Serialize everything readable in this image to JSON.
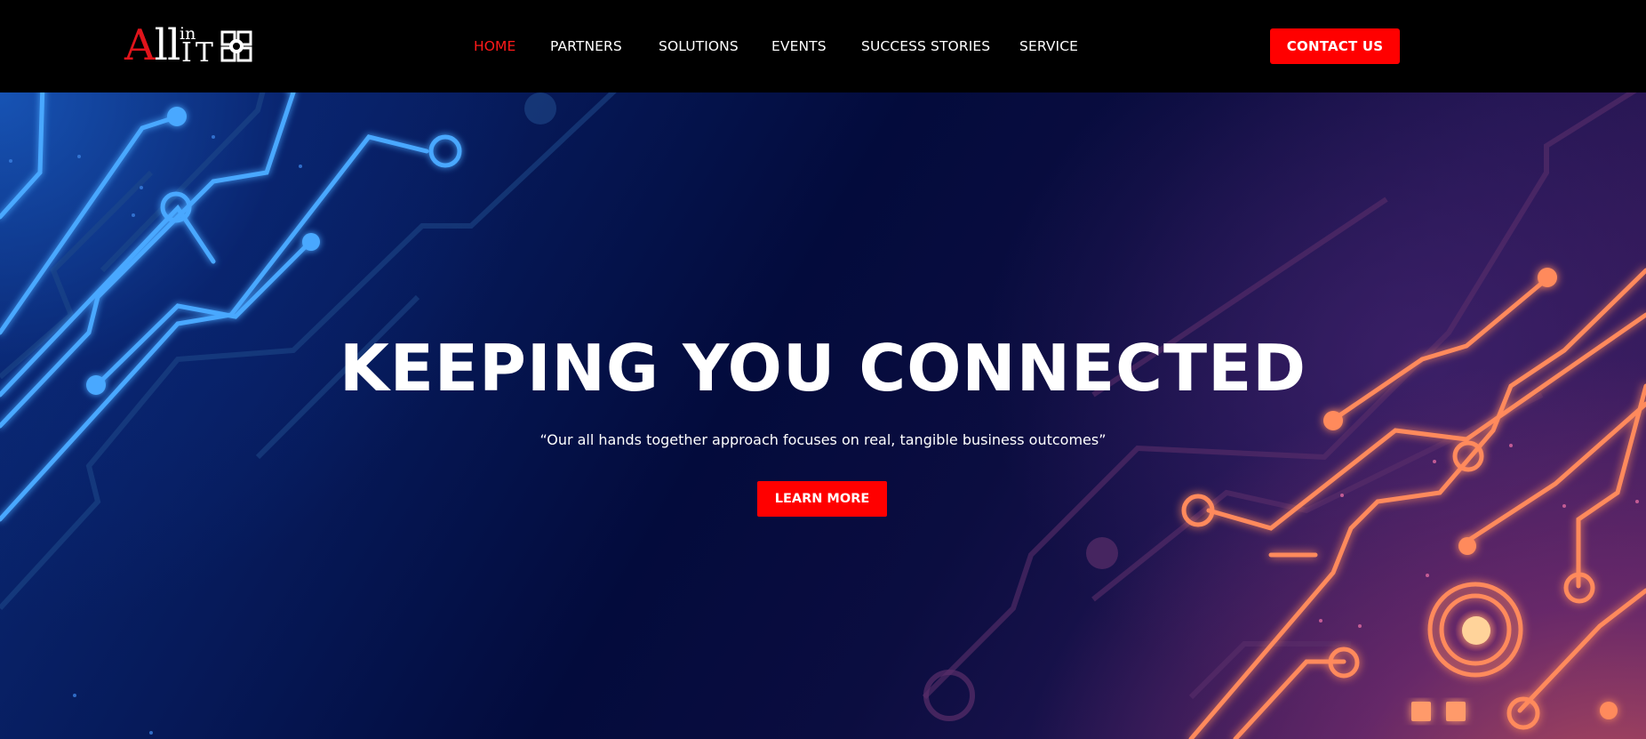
{
  "brand": {
    "logo_text_main": "All",
    "logo_text_in": "in",
    "logo_text_it": "IT",
    "logo_icon": "hands-together-icon",
    "accent_red": "#ff0000",
    "logo_red": "#e0141b"
  },
  "nav": {
    "items": [
      {
        "label": "HOME",
        "active": true
      },
      {
        "label": "PARTNERS",
        "active": false
      },
      {
        "label": "SOLUTIONS",
        "active": false
      },
      {
        "label": "EVENTS",
        "active": false
      },
      {
        "label": "SUCCESS STORIES",
        "active": false
      },
      {
        "label": "SERVICE",
        "active": false
      }
    ],
    "active_color": "#ff1a1a"
  },
  "header": {
    "contact_label": "CONTACT US"
  },
  "hero": {
    "title": "KEEPING YOU CONNECTED",
    "subtitle": "“Our all hands together approach focuses on real, tangible business outcomes”",
    "cta_label": "LEARN MORE",
    "background_theme": "circuit-board",
    "colors": {
      "blue_trace": "#4aa8ff",
      "orange_trace": "#ff8a5c",
      "deep_navy": "#030b3c"
    }
  }
}
